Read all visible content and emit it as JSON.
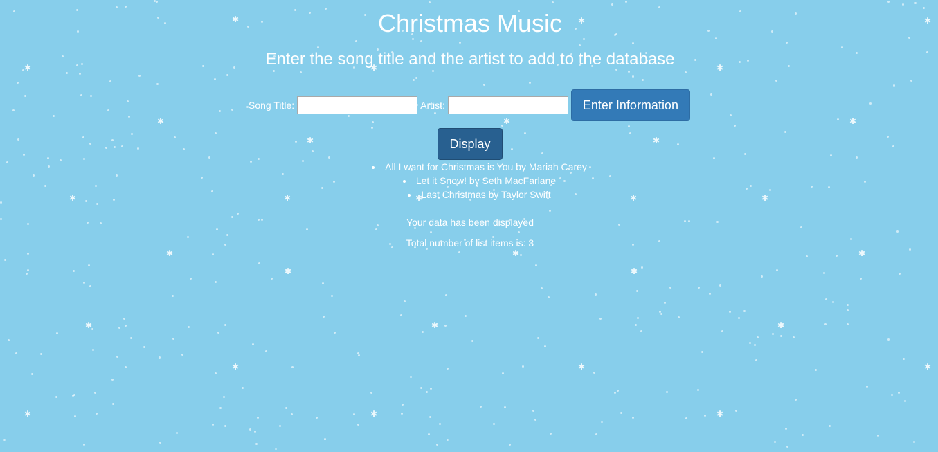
{
  "page": {
    "title": "Christmas Music",
    "subtitle": "Enter the song title and the artist to add to the database"
  },
  "form": {
    "song_title_label": "Song Title:",
    "song_title_value": "",
    "artist_label": "Artist:",
    "artist_value": "",
    "enter_button_label": "Enter Information"
  },
  "display_button_label": "Display",
  "songs": [
    "All I want for Christmas is You by Mariah Carey",
    "Let it Snow! by Seth MacFarlane",
    "Last Christmas by Taylor Swift"
  ],
  "status": {
    "displayed_message": "Your data has been displayed",
    "count_message": "Total number of list items is: 3"
  },
  "colors": {
    "background": "#87ceeb",
    "button": "#337ab7",
    "button_active": "#286090",
    "text": "#ffffff"
  }
}
